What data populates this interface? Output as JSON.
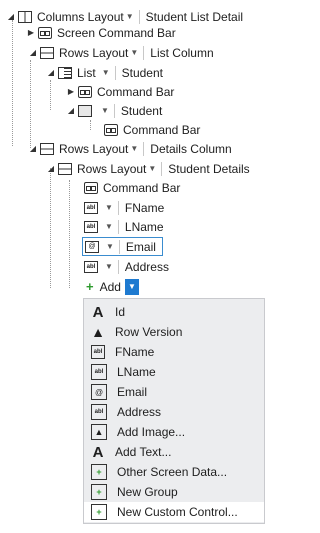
{
  "tree": {
    "root": {
      "type": "Columns Layout",
      "name": "Student List Detail"
    },
    "screen_command_bar": "Screen Command Bar",
    "rows_layout_1": {
      "type": "Rows Layout",
      "name": "List Column"
    },
    "list": {
      "type": "List",
      "name": "Student"
    },
    "list_command_bar": "Command Bar",
    "student_item": {
      "name": "Student"
    },
    "student_command_bar": "Command Bar",
    "rows_layout_2": {
      "type": "Rows Layout",
      "name": "Details Column"
    },
    "rows_layout_3": {
      "type": "Rows Layout",
      "name": "Student Details"
    },
    "details_command_bar": "Command Bar",
    "fields": [
      "FName",
      "LName",
      "Email",
      "Address"
    ],
    "add_label": "Add"
  },
  "menu": {
    "items": [
      {
        "label": "Id",
        "icon": "letter-a-icon"
      },
      {
        "label": "Row Version",
        "icon": "warning-triangle-icon"
      },
      {
        "label": "FName",
        "icon": "text-box-icon"
      },
      {
        "label": "LName",
        "icon": "text-box-icon"
      },
      {
        "label": "Email",
        "icon": "email-address-icon"
      },
      {
        "label": "Address",
        "icon": "text-box-icon"
      },
      {
        "label": "Add Image...",
        "icon": "image-icon"
      },
      {
        "label": "Add Text...",
        "icon": "letter-a-icon"
      },
      {
        "label": "Other Screen Data...",
        "icon": "screen-data-icon"
      },
      {
        "label": "New Group",
        "icon": "new-group-icon"
      },
      {
        "label": "New Custom Control...",
        "icon": "custom-control-icon"
      }
    ],
    "highlighted": "New Custom Control..."
  },
  "colors": {
    "accent": "#1e7ad0",
    "selection_border": "#3a8ccf",
    "menu_bg": "#ecedef",
    "add_plus": "#2e9a2e"
  }
}
